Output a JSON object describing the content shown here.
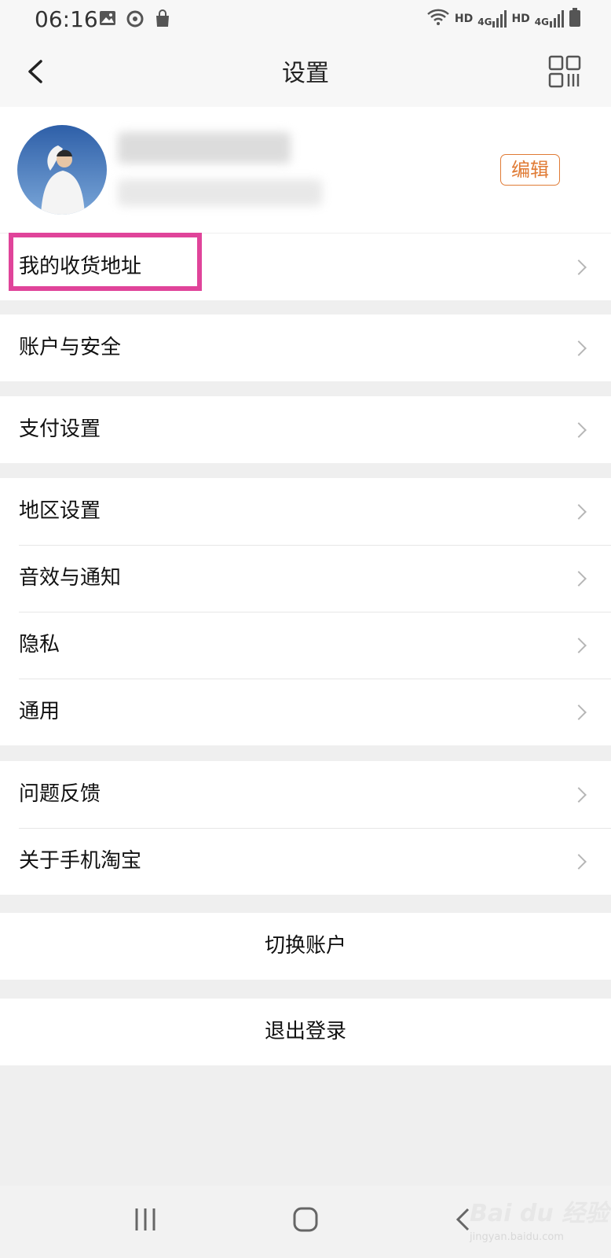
{
  "status_bar": {
    "time": "06:16",
    "hd1": "HD",
    "net1": "4G",
    "hd2": "HD",
    "net2": "4G",
    "icons": [
      "image-icon",
      "sync-icon",
      "shopping-bag-icon",
      "wifi-icon",
      "signal-icon",
      "battery-icon"
    ]
  },
  "nav": {
    "title": "设置",
    "back_icon": "back-arrow-icon",
    "qr_icon": "qr-code-icon"
  },
  "profile": {
    "edit_label": "编辑"
  },
  "groups": [
    {
      "items": [
        {
          "label": "我的收货地址"
        }
      ]
    },
    {
      "items": [
        {
          "label": "账户与安全"
        }
      ]
    },
    {
      "items": [
        {
          "label": "支付设置"
        }
      ]
    },
    {
      "items": [
        {
          "label": "地区设置"
        },
        {
          "label": "音效与通知"
        },
        {
          "label": "隐私"
        },
        {
          "label": "通用"
        }
      ]
    },
    {
      "items": [
        {
          "label": "问题反馈"
        },
        {
          "label": "关于手机淘宝"
        }
      ]
    }
  ],
  "actions": {
    "switch_account": "切换账户",
    "logout": "退出登录"
  },
  "watermark": {
    "brand": "Bai du",
    "brand_cn": "经验",
    "url": "jingyan.baidu.com"
  },
  "colors": {
    "accent": "#e07b35",
    "highlight": "#e0449a",
    "background": "#efefef"
  }
}
